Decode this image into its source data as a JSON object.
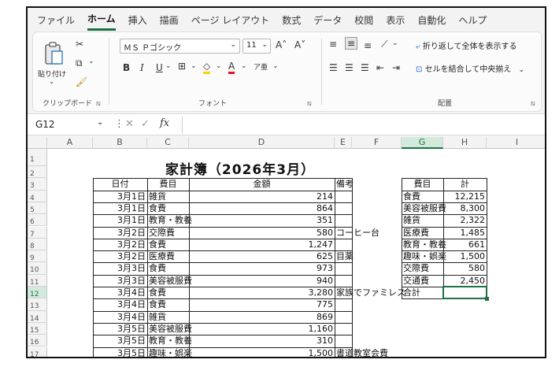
{
  "tabs": [
    "ファイル",
    "ホーム",
    "挿入",
    "描画",
    "ページ レイアウト",
    "数式",
    "データ",
    "校閲",
    "表示",
    "自動化",
    "ヘルプ"
  ],
  "active_tab": "ホーム",
  "ribbon": {
    "paste_label": "貼り付け",
    "clipboard_group": "クリップボード",
    "font_name": "ＭＳ Ｐゴシック",
    "font_size": "11",
    "font_group": "フォント",
    "wrap_text": "折り返して全体を表示する",
    "merge_center": "セルを結合して中央揃え",
    "alignment_group": "配置",
    "bold": "B",
    "italic": "I",
    "underline": "U"
  },
  "formula_bar": {
    "name_box": "G12",
    "fx": "fx",
    "formula": ""
  },
  "columns": [
    "A",
    "B",
    "C",
    "D",
    "E",
    "F",
    "G",
    "H",
    "I"
  ],
  "rows": [
    "1",
    "2",
    "3",
    "4",
    "5",
    "6",
    "7",
    "8",
    "9",
    "10",
    "11",
    "12",
    "13",
    "14",
    "15",
    "16",
    "17"
  ],
  "selected_cell": "G12",
  "sheet": {
    "title": "家計簿（2026年3月）",
    "headers": [
      "日付",
      "費目",
      "金額",
      "備考"
    ],
    "records": [
      {
        "date": "3月1日",
        "category": "雑貨",
        "amount": "214",
        "note": ""
      },
      {
        "date": "3月1日",
        "category": "食費",
        "amount": "864",
        "note": ""
      },
      {
        "date": "3月1日",
        "category": "教育・教養",
        "amount": "351",
        "note": ""
      },
      {
        "date": "3月2日",
        "category": "交際費",
        "amount": "580",
        "note": "コーヒー台"
      },
      {
        "date": "3月2日",
        "category": "食費",
        "amount": "1,247",
        "note": ""
      },
      {
        "date": "3月2日",
        "category": "医療費",
        "amount": "625",
        "note": "目薬"
      },
      {
        "date": "3月3日",
        "category": "食費",
        "amount": "973",
        "note": ""
      },
      {
        "date": "3月3日",
        "category": "美容被服費",
        "amount": "940",
        "note": ""
      },
      {
        "date": "3月4日",
        "category": "食費",
        "amount": "3,280",
        "note": "家族でファミレス"
      },
      {
        "date": "3月4日",
        "category": "食費",
        "amount": "775",
        "note": ""
      },
      {
        "date": "3月4日",
        "category": "雑貨",
        "amount": "869",
        "note": ""
      },
      {
        "date": "3月5日",
        "category": "美容被服費",
        "amount": "1,160",
        "note": ""
      },
      {
        "date": "3月5日",
        "category": "教育・教養",
        "amount": "310",
        "note": ""
      },
      {
        "date": "3月5日",
        "category": "趣味・娯楽",
        "amount": "1,500",
        "note": "書道教室会費"
      }
    ],
    "summary_headers": [
      "費目",
      "計"
    ],
    "summary": [
      {
        "category": "食費",
        "total": "12,215"
      },
      {
        "category": "美容被服費",
        "total": "8,300"
      },
      {
        "category": "雑貨",
        "total": "2,322"
      },
      {
        "category": "医療費",
        "total": "1,485"
      },
      {
        "category": "教育・教養",
        "total": "661"
      },
      {
        "category": "趣味・娯楽",
        "total": "1,500"
      },
      {
        "category": "交際費",
        "total": "580"
      },
      {
        "category": "交通費",
        "total": "2,450"
      },
      {
        "category": "合計",
        "total": ""
      }
    ]
  },
  "colors": {
    "accent": "#1e7145",
    "header_bg": "#f3f3f3",
    "selected_header": "#d3e9dc"
  }
}
